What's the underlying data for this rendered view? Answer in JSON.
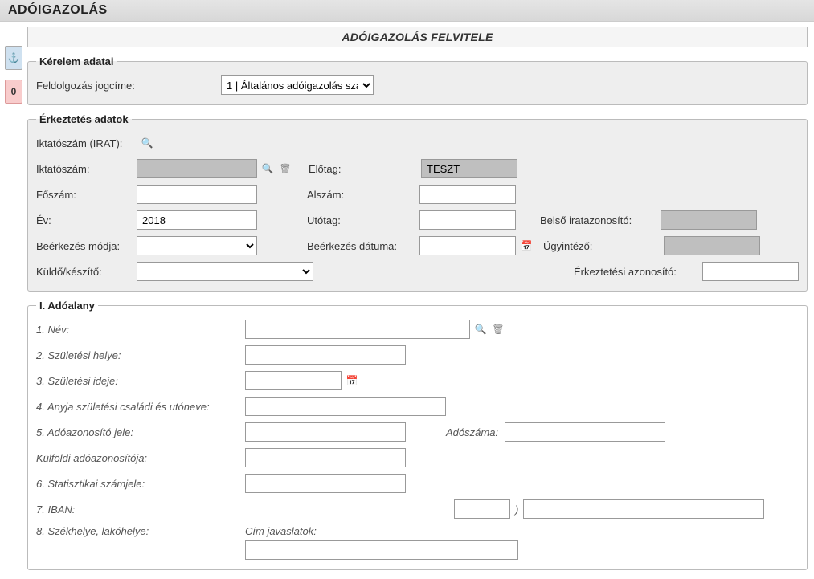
{
  "header": {
    "title": "ADÓIGAZOLÁS"
  },
  "subtitle": "ADÓIGAZOLÁS FELVITELE",
  "side": {
    "anchor_symbol": "⚓",
    "error_count": "0"
  },
  "kerelem": {
    "legend": "Kérelem adatai",
    "feldolgozas_label": "Feldolgozás jogcíme:",
    "feldolgozas_value": "1 | Általános adóigazolás szá"
  },
  "erkeztetes": {
    "legend": "Érkeztetés adatok",
    "iktatoszam_irat_label": "Iktatószám (IRAT):",
    "iktatoszam_label": "Iktatószám:",
    "iktatoszam_value": "",
    "elotag_label": "Előtag:",
    "elotag_value": "TESZT",
    "foszam_label": "Főszám:",
    "foszam_value": "",
    "alszam_label": "Alszám:",
    "alszam_value": "",
    "ev_label": "Év:",
    "ev_value": "2018",
    "utotag_label": "Utótag:",
    "utotag_value": "",
    "belso_label": "Belső iratazonosító:",
    "belso_value": "",
    "beerkezes_modja_label": "Beérkezés módja:",
    "beerkezes_modja_value": "",
    "beerkezes_datuma_label": "Beérkezés dátuma:",
    "beerkezes_datuma_value": "",
    "ugyintezo_label": "Ügyintéző:",
    "ugyintezo_value": "",
    "kuldo_label": "Küldő/készítő:",
    "kuldo_value": "",
    "erk_azonosito_label": "Érkeztetési azonosító:",
    "erk_azonosito_value": ""
  },
  "adoalany": {
    "legend": "I. Adóalany",
    "nev_label": "1. Név:",
    "nev_value": "",
    "szuletesi_hely_label": "2. Születési helye:",
    "szuletesi_hely_value": "",
    "szuletesi_ideje_label": "3. Születési ideje:",
    "szuletesi_ideje_value": "",
    "anyja_label": "4. Anyja születési családi és utóneve:",
    "anyja_value": "",
    "adoazonosito_label": "5. Adóazonosító jele:",
    "adoazonosito_value": "",
    "adoszama_label": "Adószáma:",
    "adoszama_value": "",
    "kulfoldi_label": "Külföldi adóazonosítója:",
    "kulfoldi_value": "",
    "statisztikai_label": "6. Statisztikai számjele:",
    "statisztikai_value": "",
    "iban_label": "7. IBAN:",
    "iban_short_value": "",
    "iban_long_value": "",
    "szekhely_label": "8. Székhelye, lakóhelye:",
    "cim_javaslatok_label": "Cím javaslatok:",
    "cim_javaslatok_value": ""
  }
}
